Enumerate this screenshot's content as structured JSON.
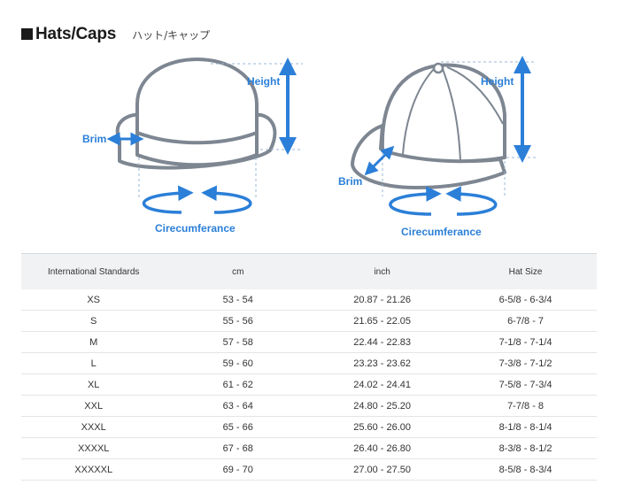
{
  "header": {
    "title": "Hats/Caps",
    "subtitle": "ハット/キャップ"
  },
  "diagram": {
    "hat": {
      "height_label": "Height",
      "brim_label": "Brim",
      "circumference_label": "Cirecumferance"
    },
    "cap": {
      "height_label": "Height",
      "brim_label": "Brim",
      "circumference_label": "Cirecumferance"
    }
  },
  "colors": {
    "accent": "#2b7fd8",
    "outline": "#7d8691",
    "guide": "#9ab7d6"
  },
  "table": {
    "headers": [
      "International Standards",
      "cm",
      "inch",
      "Hat Size"
    ],
    "rows": [
      [
        "XS",
        "53 - 54",
        "20.87 - 21.26",
        "6-5/8 - 6-3/4"
      ],
      [
        "S",
        "55 - 56",
        "21.65 - 22.05",
        "6-7/8 - 7"
      ],
      [
        "M",
        "57 - 58",
        "22.44 - 22.83",
        "7-1/8 - 7-1/4"
      ],
      [
        "L",
        "59 - 60",
        "23.23 - 23.62",
        "7-3/8 - 7-1/2"
      ],
      [
        "XL",
        "61 - 62",
        "24.02 - 24.41",
        "7-5/8 - 7-3/4"
      ],
      [
        "XXL",
        "63 - 64",
        "24.80 - 25.20",
        "7-7/8 - 8"
      ],
      [
        "XXXL",
        "65 - 66",
        "25.60 - 26.00",
        "8-1/8 - 8-1/4"
      ],
      [
        "XXXXL",
        "67 - 68",
        "26.40 - 26.80",
        "8-3/8 - 8-1/2"
      ],
      [
        "XXXXXL",
        "69 - 70",
        "27.00 - 27.50",
        "8-5/8 - 8-3/4"
      ]
    ]
  }
}
